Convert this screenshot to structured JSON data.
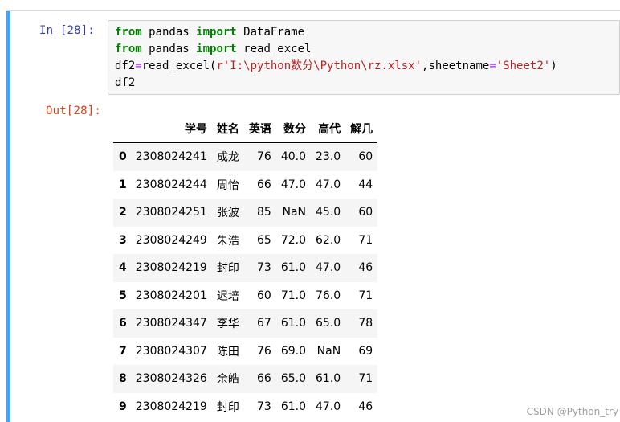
{
  "input_prompt": "In  [28]:",
  "output_prompt": "Out[28]:",
  "code": {
    "line1": {
      "kw1": "from",
      "mod": " pandas ",
      "kw2": "import",
      "name": " DataFrame"
    },
    "line2": {
      "kw1": "from",
      "mod": " pandas ",
      "kw2": "import",
      "name": " read_excel"
    },
    "line3": {
      "var": "df2",
      "eq": "=",
      "call": "read_excel(",
      "path": "r'I:\\python数分\\Python\\rz.xlsx'",
      "comma": ",sheetname",
      "eq2": "=",
      "sheet": "'Sheet2'",
      "close": ")"
    },
    "line4": "df2"
  },
  "dataframe": {
    "columns": [
      "",
      "学号",
      "姓名",
      "英语",
      "数分",
      "高代",
      "解几"
    ],
    "rows": [
      [
        "0",
        "2308024241",
        "成龙",
        "76",
        "40.0",
        "23.0",
        "60"
      ],
      [
        "1",
        "2308024244",
        "周怡",
        "66",
        "47.0",
        "47.0",
        "44"
      ],
      [
        "2",
        "2308024251",
        "张波",
        "85",
        "NaN",
        "45.0",
        "60"
      ],
      [
        "3",
        "2308024249",
        "朱浩",
        "65",
        "72.0",
        "62.0",
        "71"
      ],
      [
        "4",
        "2308024219",
        "封印",
        "73",
        "61.0",
        "47.0",
        "46"
      ],
      [
        "5",
        "2308024201",
        "迟培",
        "60",
        "71.0",
        "76.0",
        "71"
      ],
      [
        "6",
        "2308024347",
        "李华",
        "67",
        "61.0",
        "65.0",
        "78"
      ],
      [
        "7",
        "2308024307",
        "陈田",
        "76",
        "69.0",
        "NaN",
        "69"
      ],
      [
        "8",
        "2308024326",
        "余皓",
        "66",
        "65.0",
        "61.0",
        "71"
      ],
      [
        "9",
        "2308024219",
        "封印",
        "73",
        "61.0",
        "47.0",
        "46"
      ]
    ]
  },
  "watermark": "CSDN @Python_try",
  "colors": {
    "selection_bar": "#42a5f5",
    "in_prompt": "#303f9f",
    "out_prompt": "#d84315",
    "keyword": "#008000",
    "string": "#ba2121",
    "operator": "#aa22ff"
  }
}
